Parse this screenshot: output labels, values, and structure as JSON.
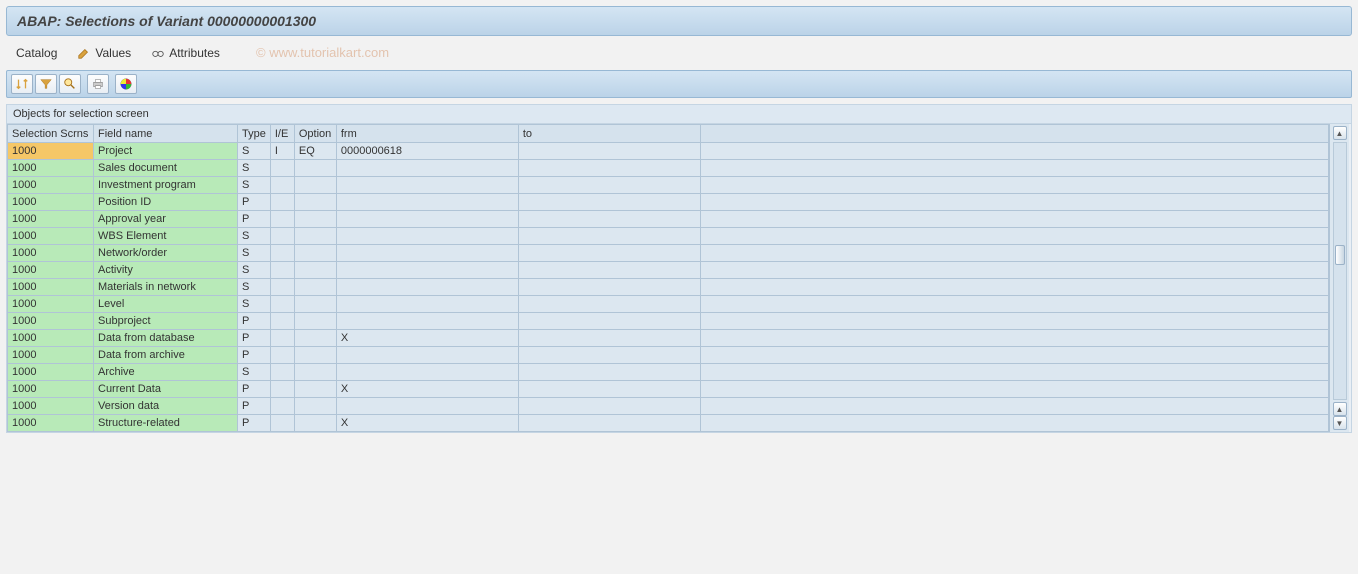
{
  "title": "ABAP: Selections of Variant 00000000001300",
  "watermark": "© www.tutorialkart.com",
  "toolbar": {
    "catalog": "Catalog",
    "values": "Values",
    "attributes": "Attributes"
  },
  "section_header": "Objects for selection screen",
  "columns": {
    "scrn": "Selection Scrns",
    "fname": "Field name",
    "type": "Type",
    "ie": "I/E",
    "option": "Option",
    "frm": "frm",
    "to": "to"
  },
  "rows": [
    {
      "scrn": "1000",
      "fname": "Project",
      "type": "S",
      "ie": "I",
      "option": "EQ",
      "frm": "0000000618",
      "to": "",
      "selected": true
    },
    {
      "scrn": "1000",
      "fname": "Sales document",
      "type": "S",
      "ie": "",
      "option": "",
      "frm": "",
      "to": ""
    },
    {
      "scrn": "1000",
      "fname": "Investment program",
      "type": "S",
      "ie": "",
      "option": "",
      "frm": "",
      "to": ""
    },
    {
      "scrn": "1000",
      "fname": "Position ID",
      "type": "P",
      "ie": "",
      "option": "",
      "frm": "",
      "to": ""
    },
    {
      "scrn": "1000",
      "fname": "Approval year",
      "type": "P",
      "ie": "",
      "option": "",
      "frm": "",
      "to": ""
    },
    {
      "scrn": "1000",
      "fname": "WBS Element",
      "type": "S",
      "ie": "",
      "option": "",
      "frm": "",
      "to": ""
    },
    {
      "scrn": "1000",
      "fname": "Network/order",
      "type": "S",
      "ie": "",
      "option": "",
      "frm": "",
      "to": ""
    },
    {
      "scrn": "1000",
      "fname": "Activity",
      "type": "S",
      "ie": "",
      "option": "",
      "frm": "",
      "to": ""
    },
    {
      "scrn": "1000",
      "fname": "Materials in network",
      "type": "S",
      "ie": "",
      "option": "",
      "frm": "",
      "to": ""
    },
    {
      "scrn": "1000",
      "fname": "Level",
      "type": "S",
      "ie": "",
      "option": "",
      "frm": "",
      "to": ""
    },
    {
      "scrn": "1000",
      "fname": "Subproject",
      "type": "P",
      "ie": "",
      "option": "",
      "frm": "",
      "to": ""
    },
    {
      "scrn": "1000",
      "fname": "Data from database",
      "type": "P",
      "ie": "",
      "option": "",
      "frm": "X",
      "to": ""
    },
    {
      "scrn": "1000",
      "fname": "Data from archive",
      "type": "P",
      "ie": "",
      "option": "",
      "frm": "",
      "to": ""
    },
    {
      "scrn": "1000",
      "fname": "Archive",
      "type": "S",
      "ie": "",
      "option": "",
      "frm": "",
      "to": ""
    },
    {
      "scrn": "1000",
      "fname": "Current Data",
      "type": "P",
      "ie": "",
      "option": "",
      "frm": "X",
      "to": ""
    },
    {
      "scrn": "1000",
      "fname": "Version data",
      "type": "P",
      "ie": "",
      "option": "",
      "frm": "",
      "to": ""
    },
    {
      "scrn": "1000",
      "fname": "Structure-related",
      "type": "P",
      "ie": "",
      "option": "",
      "frm": "X",
      "to": ""
    }
  ]
}
